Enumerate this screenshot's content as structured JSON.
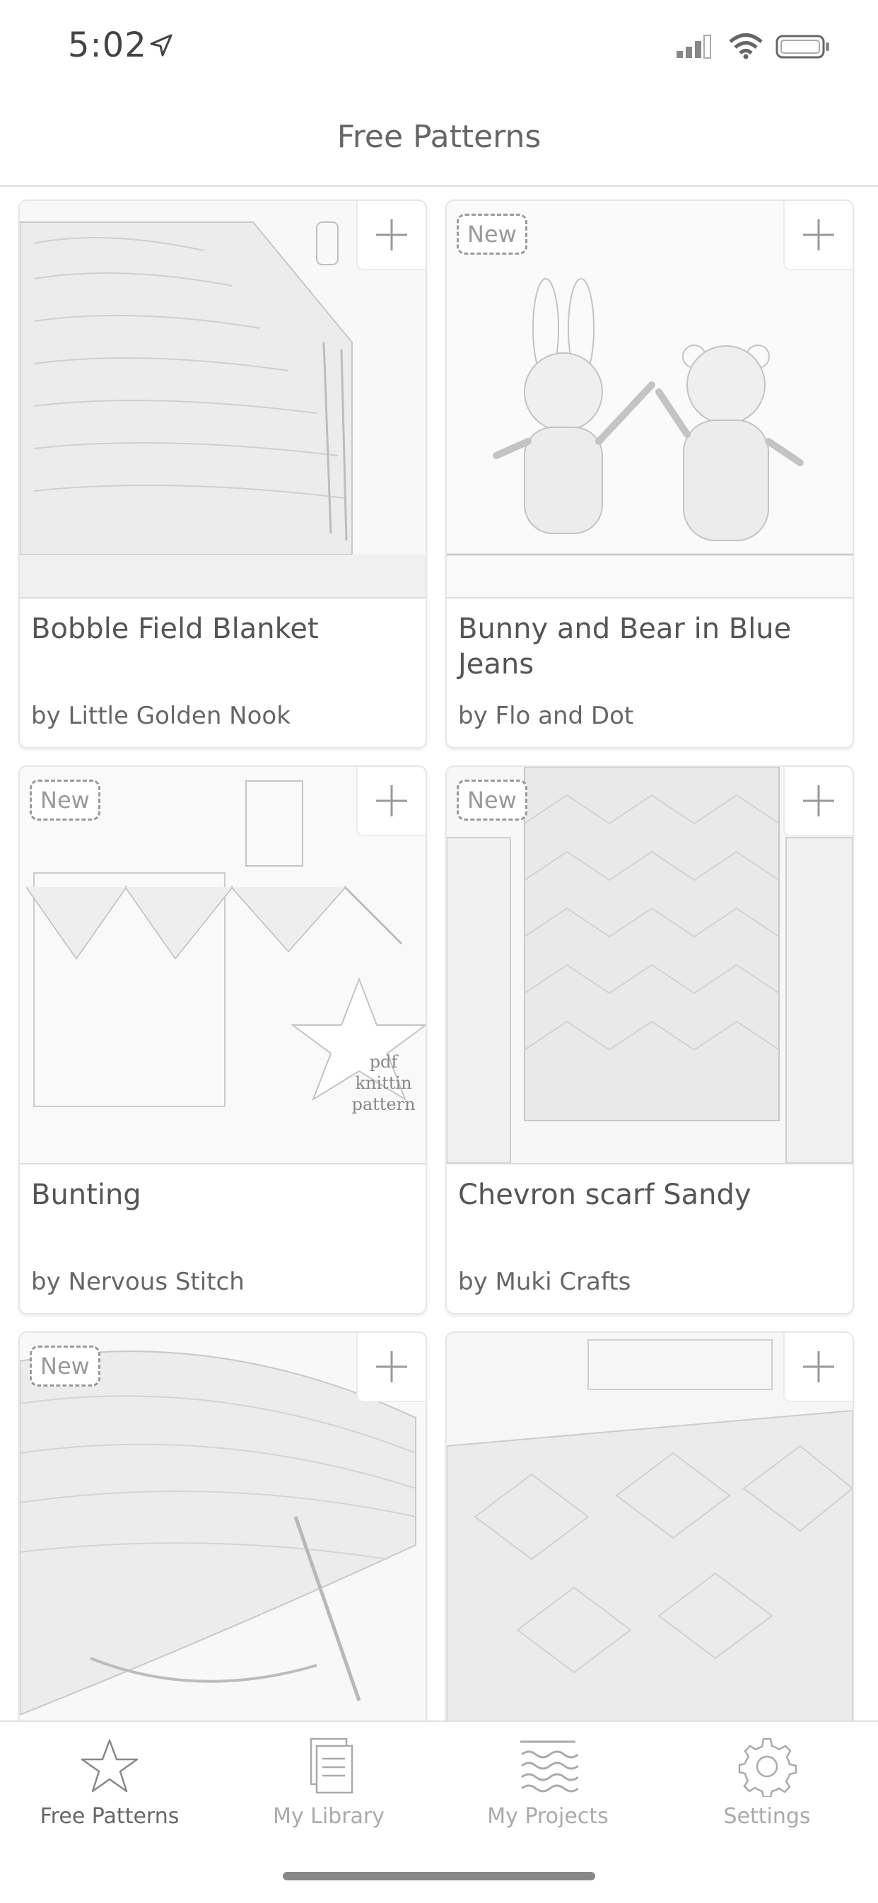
{
  "status_bar": {
    "time": "5:02"
  },
  "header": {
    "title": "Free Patterns"
  },
  "badge_label": "New",
  "patterns": [
    {
      "title": "Bobble Field Blanket",
      "author": "by Little Golden Nook",
      "is_new": false
    },
    {
      "title": "Bunny and Bear in Blue Jeans",
      "author": "by Flo and Dot",
      "is_new": true
    },
    {
      "title": "Bunting",
      "author": "by Nervous Stitch",
      "is_new": true,
      "image_text": [
        "pdf knittin",
        "pattern"
      ]
    },
    {
      "title": "Chevron scarf Sandy",
      "author": "by Muki Crafts",
      "is_new": true
    },
    {
      "title": "",
      "author": "",
      "is_new": true
    },
    {
      "title": "",
      "author": "",
      "is_new": false
    }
  ],
  "tabs": [
    {
      "label": "Free Patterns",
      "icon": "star-icon",
      "active": true
    },
    {
      "label": "My Library",
      "icon": "library-icon",
      "active": false
    },
    {
      "label": "My Projects",
      "icon": "projects-icon",
      "active": false
    },
    {
      "label": "Settings",
      "icon": "gear-icon",
      "active": false
    }
  ]
}
